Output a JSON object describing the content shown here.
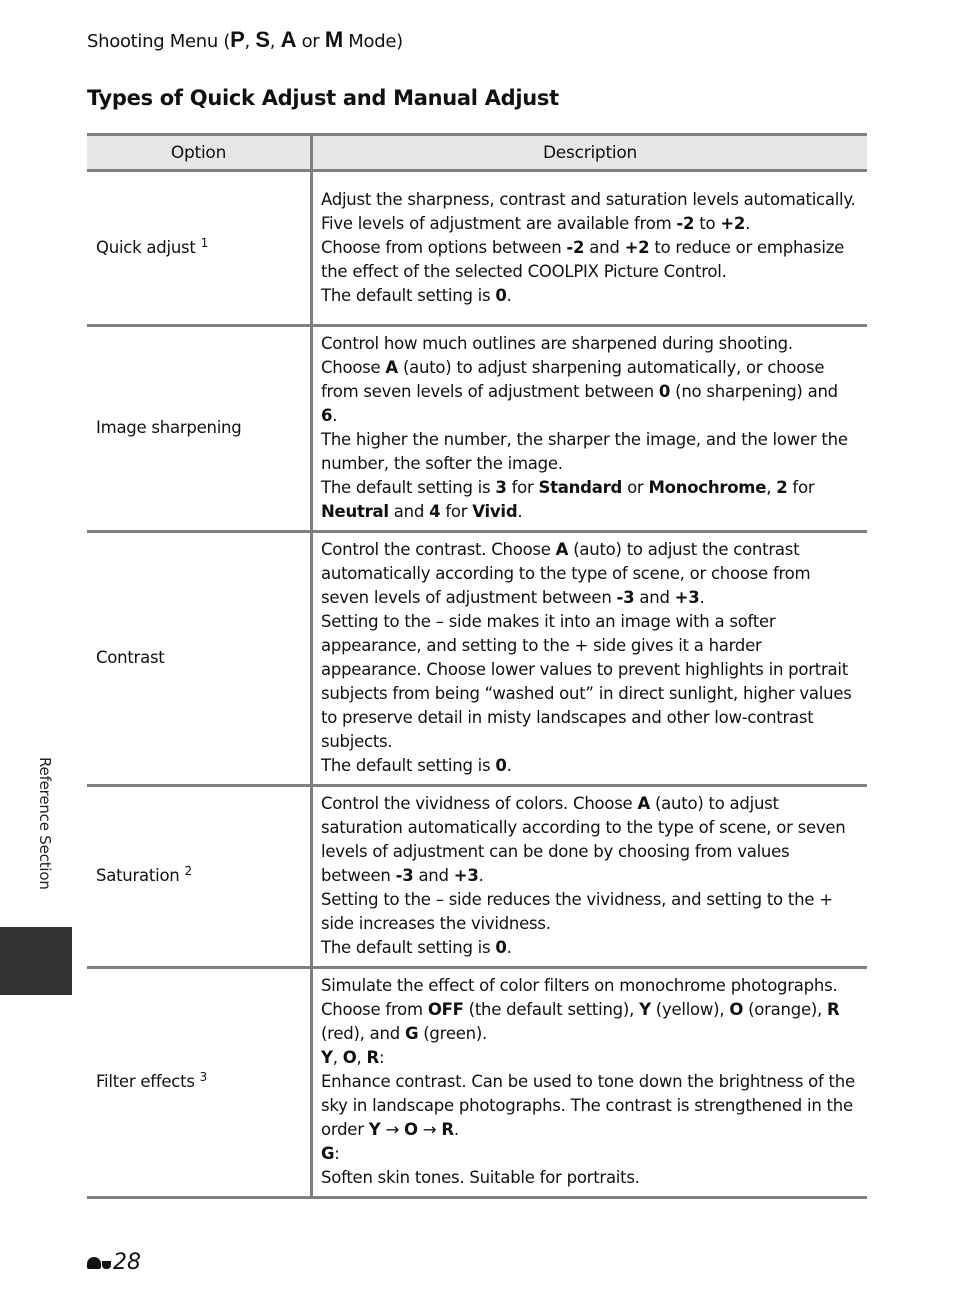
{
  "header": {
    "running_head_prefix": "Shooting Menu (",
    "mode_p": "P",
    "sep1": ", ",
    "mode_s": "S",
    "sep2": ", ",
    "mode_a": "A",
    "sep3": " or ",
    "mode_m": "M",
    "running_head_suffix": " Mode)"
  },
  "section_title": "Types of Quick Adjust and Manual Adjust",
  "table": {
    "columns": [
      "Option",
      "Description"
    ],
    "rows": [
      {
        "option": "Quick adjust",
        "footnote": "1",
        "description": [
          [
            {
              "t": "Adjust the sharpness, contrast and saturation levels automatically. Five levels of adjustment are available from "
            },
            {
              "b": "-2"
            },
            {
              "t": " to "
            },
            {
              "b": "+2"
            },
            {
              "t": "."
            }
          ],
          [
            {
              "t": "Choose from options between "
            },
            {
              "b": "-2"
            },
            {
              "t": " and "
            },
            {
              "b": "+2"
            },
            {
              "t": " to reduce or emphasize the effect of the selected COOLPIX Picture Control."
            }
          ],
          [
            {
              "t": "The default setting is "
            },
            {
              "b": "0"
            },
            {
              "t": "."
            }
          ]
        ]
      },
      {
        "option": "Image sharpening",
        "footnote": "",
        "description": [
          [
            {
              "t": "Control how much outlines are sharpened during shooting."
            }
          ],
          [
            {
              "t": "Choose "
            },
            {
              "b": "A"
            },
            {
              "t": " (auto) to adjust sharpening automatically, or choose from seven levels of adjustment between "
            },
            {
              "b": "0"
            },
            {
              "t": " (no sharpening) and "
            },
            {
              "b": "6"
            },
            {
              "t": "."
            }
          ],
          [
            {
              "t": "The higher the number, the sharper the image, and the lower the number, the softer the image."
            }
          ],
          [
            {
              "t": "The default setting is "
            },
            {
              "b": "3"
            },
            {
              "t": " for "
            },
            {
              "b": "Standard"
            },
            {
              "t": " or "
            },
            {
              "b": "Monochrome"
            },
            {
              "t": ", "
            },
            {
              "b": "2"
            },
            {
              "t": " for "
            },
            {
              "b": "Neutral"
            },
            {
              "t": " and "
            },
            {
              "b": "4"
            },
            {
              "t": " for "
            },
            {
              "b": "Vivid"
            },
            {
              "t": "."
            }
          ]
        ]
      },
      {
        "option": "Contrast",
        "footnote": "",
        "description": [
          [
            {
              "t": "Control the contrast. Choose "
            },
            {
              "b": "A"
            },
            {
              "t": " (auto) to adjust the contrast automatically according to the type of scene, or choose from seven levels of adjustment between "
            },
            {
              "b": "-3"
            },
            {
              "t": " and "
            },
            {
              "b": "+3"
            },
            {
              "t": "."
            }
          ],
          [
            {
              "t": "Setting to the – side makes it into an image with a softer appearance, and setting to the + side gives it a harder appearance. Choose lower values to prevent highlights in portrait subjects from being “washed out” in direct sunlight, higher values to preserve detail in misty landscapes and other low-contrast subjects."
            }
          ],
          [
            {
              "t": "The default setting is "
            },
            {
              "b": "0"
            },
            {
              "t": "."
            }
          ]
        ]
      },
      {
        "option": "Saturation",
        "footnote": "2",
        "description": [
          [
            {
              "t": "Control the vividness of colors. Choose "
            },
            {
              "b": "A"
            },
            {
              "t": " (auto) to adjust saturation automatically according to the type of scene, or seven levels of adjustment can be done by choosing from values between "
            },
            {
              "b": "-3"
            },
            {
              "t": " and "
            },
            {
              "b": "+3"
            },
            {
              "t": "."
            }
          ],
          [
            {
              "t": "Setting to the – side reduces the vividness, and setting to the + side increases the vividness."
            }
          ],
          [
            {
              "t": "The default setting is "
            },
            {
              "b": "0"
            },
            {
              "t": "."
            }
          ]
        ]
      },
      {
        "option": "Filter effects",
        "footnote": "3",
        "description": [
          [
            {
              "t": "Simulate the effect of color filters on monochrome photographs. Choose from "
            },
            {
              "b": "OFF"
            },
            {
              "t": " (the default setting), "
            },
            {
              "b": "Y"
            },
            {
              "t": " (yellow), "
            },
            {
              "b": "O"
            },
            {
              "t": " (orange), "
            },
            {
              "b": "R"
            },
            {
              "t": " (red), and "
            },
            {
              "b": "G"
            },
            {
              "t": " (green)."
            }
          ],
          [
            {
              "b": "Y"
            },
            {
              "t": ", "
            },
            {
              "b": "O"
            },
            {
              "t": ", "
            },
            {
              "b": "R"
            },
            {
              "t": ":"
            }
          ],
          [
            {
              "t": "Enhance contrast. Can be used to tone down the brightness of the sky in landscape photographs. The contrast is strengthened in the order "
            },
            {
              "b": "Y"
            },
            {
              "t": " → "
            },
            {
              "b": "O"
            },
            {
              "t": " → "
            },
            {
              "b": "R"
            },
            {
              "t": "."
            }
          ],
          [
            {
              "b": "G"
            },
            {
              "t": ":"
            }
          ],
          [
            {
              "t": "Soften skin tones. Suitable for portraits."
            }
          ]
        ]
      }
    ]
  },
  "side_label": "Reference Section",
  "footer": {
    "page_icon": "reference-section-icon",
    "page_number": "28"
  },
  "colors": {
    "rule": "#7f7f7f",
    "header_fill": "#e6e6e6",
    "side_tab": "#333333"
  }
}
